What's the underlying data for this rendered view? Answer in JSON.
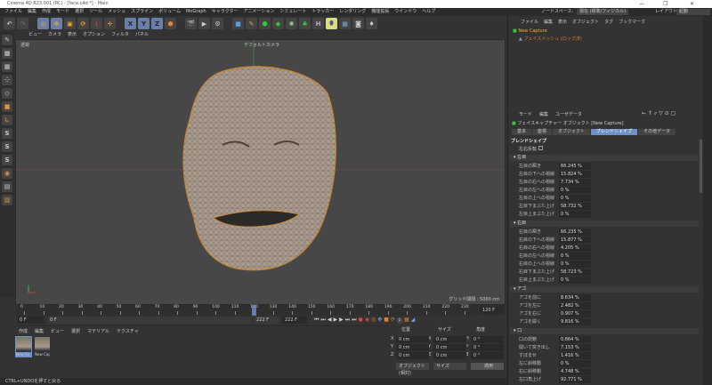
{
  "window": {
    "title": "Cinema 4D R23.001 (RC) - [face.c4d *] - Main",
    "minimize": "—",
    "maximize": "❐",
    "close": "✕"
  },
  "menu": [
    "ファイル",
    "編集",
    "作成",
    "モード",
    "選択",
    "ツール",
    "メッシュ",
    "スプライン",
    "ボリューム",
    "MoGraph",
    "キャラクター",
    "アニメーション",
    "シミュレート",
    "トラッカー",
    "レンダリング",
    "機能拡張",
    "ウインドウ",
    "ヘルプ"
  ],
  "toolbar": {
    "x": "X",
    "y": "Y",
    "z": "Z"
  },
  "topright": {
    "nodespace_label": "ノードスペース:",
    "nodespace_value": "現在 (標準/フィジカル)",
    "layout_label": "レイアウト:",
    "layout_value": "起動"
  },
  "viewport": {
    "menu": [
      "ビュー",
      "カメラ",
      "表示",
      "オプション",
      "フィルタ",
      "パネル"
    ],
    "projection": "透視",
    "camera": "デフォルトカメラ",
    "grid": "グリッド間隔 : 5000 cm"
  },
  "timeline": {
    "ticks": [
      0,
      10,
      20,
      30,
      40,
      50,
      60,
      70,
      80,
      90,
      100,
      110,
      120,
      130,
      140,
      150,
      160,
      170,
      180,
      190,
      200,
      210,
      220,
      230
    ],
    "current": 120,
    "max": 230,
    "start": "0 F",
    "start2": "0 F",
    "end": "222 F",
    "end2": "222 F",
    "current_label": "120 F"
  },
  "materials": {
    "menu": [
      "作成",
      "編集",
      "ビュー",
      "選択",
      "マテリアル",
      "テクスチャ"
    ],
    "items": [
      "New Ca",
      "New Cap"
    ]
  },
  "coords": {
    "pos": "位置",
    "size": "サイズ",
    "rot": "角度",
    "rows": [
      {
        "a": "X",
        "v": "0 cm",
        "b": "X",
        "s": "0 cm",
        "c": "H",
        "r": "0 °"
      },
      {
        "a": "Y",
        "v": "0 cm",
        "b": "Y",
        "s": "0 cm",
        "c": "P",
        "r": "0 °"
      },
      {
        "a": "Z",
        "v": "0 cm",
        "b": "Z",
        "s": "0 cm",
        "c": "B",
        "r": "0 °"
      }
    ],
    "mode": "オブジェクト (相対)",
    "size_mode": "サイズ",
    "apply": "適用"
  },
  "status": "CTRL+UNDOを押すと戻る",
  "objects": {
    "menu": [
      "ファイル",
      "編集",
      "表示",
      "オブジェクト",
      "タグ",
      "ブックマーク"
    ],
    "items": [
      "New Capture",
      "フェイスメッシュ (ロック済)"
    ]
  },
  "attributes": {
    "menu": [
      "モード",
      "編集",
      "ユーザデータ"
    ],
    "title": "フェイスキャプチャー オブジェクト [New Capture]",
    "tabs": [
      "基本",
      "座標",
      "オブジェクト",
      "ブレンドシェイプ",
      "その他データ"
    ],
    "active_tab": 3,
    "section": "ブレンドシェイプ",
    "mirror": "左右反転",
    "groups": [
      {
        "name": "左目",
        "rows": [
          [
            "左目の瞬き",
            "66.245 %"
          ],
          [
            "左目の下への視線",
            "15.824 %"
          ],
          [
            "左目の右への視線",
            "7.734 %"
          ],
          [
            "左目の左への視線",
            "0 %"
          ],
          [
            "左目の上への視線",
            "0 %"
          ],
          [
            "左目下まぶた上げ",
            "58.732 %"
          ],
          [
            "左目上まぶた上げ",
            "0 %"
          ]
        ]
      },
      {
        "name": "右目",
        "rows": [
          [
            "右目の瞬き",
            "66.235 %"
          ],
          [
            "右目の下への視線",
            "15.877 %"
          ],
          [
            "右目の右への視線",
            "4.205 %"
          ],
          [
            "右目の左への視線",
            "0 %"
          ],
          [
            "右目の上への視線",
            "0 %"
          ],
          [
            "右目下まぶた上げ",
            "58.723 %"
          ],
          [
            "右目上まぶた上げ",
            "0 %"
          ]
        ]
      },
      {
        "name": "アゴ",
        "rows": [
          [
            "アゴを前に",
            "8.634 %"
          ],
          [
            "アゴを左に",
            "2.482 %"
          ],
          [
            "アゴを右に",
            "0.907 %"
          ],
          [
            "アゴを開く",
            "9.816 %"
          ]
        ]
      },
      {
        "name": "口",
        "rows": [
          [
            "口の閉鎖",
            "0.864 %"
          ],
          [
            "開いて突き出し",
            "7.153 %"
          ],
          [
            "すぼませ",
            "1.416 %"
          ],
          [
            "左に斜移動",
            "0 %"
          ],
          [
            "右に斜移動",
            "4.748 %"
          ],
          [
            "左口角上げ",
            "92.771 %"
          ]
        ]
      }
    ]
  }
}
